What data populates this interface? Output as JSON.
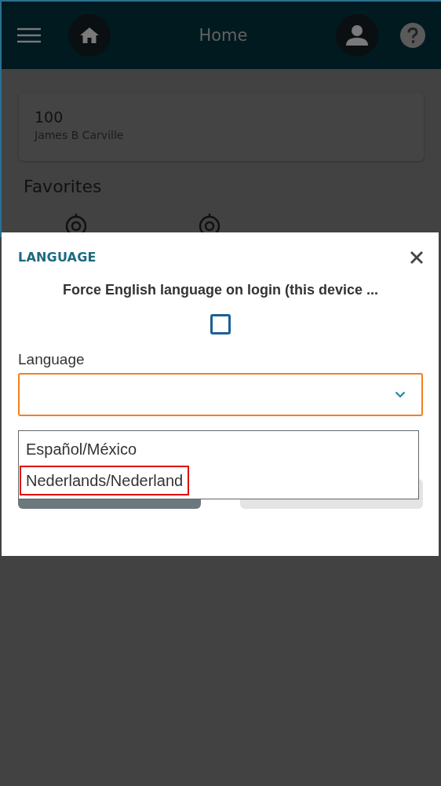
{
  "header": {
    "title": "Home"
  },
  "account_card": {
    "number": "100",
    "name": "James B Carville"
  },
  "favorites": {
    "heading": "Favorites",
    "items": [
      {
        "kind": "target"
      },
      {
        "kind": "target"
      }
    ]
  },
  "dialog": {
    "title": "LANGUAGE",
    "force_english": {
      "label": "Force English language on login (this device ...",
      "checked": false
    },
    "language": {
      "label": "Language",
      "options": [
        {
          "label": "Español/México",
          "highlighted": false
        },
        {
          "label": "Nederlands/Nederland",
          "highlighted": true
        }
      ]
    },
    "buttons": [
      {
        "kind": "primary"
      },
      {
        "kind": "secondary"
      }
    ]
  }
}
